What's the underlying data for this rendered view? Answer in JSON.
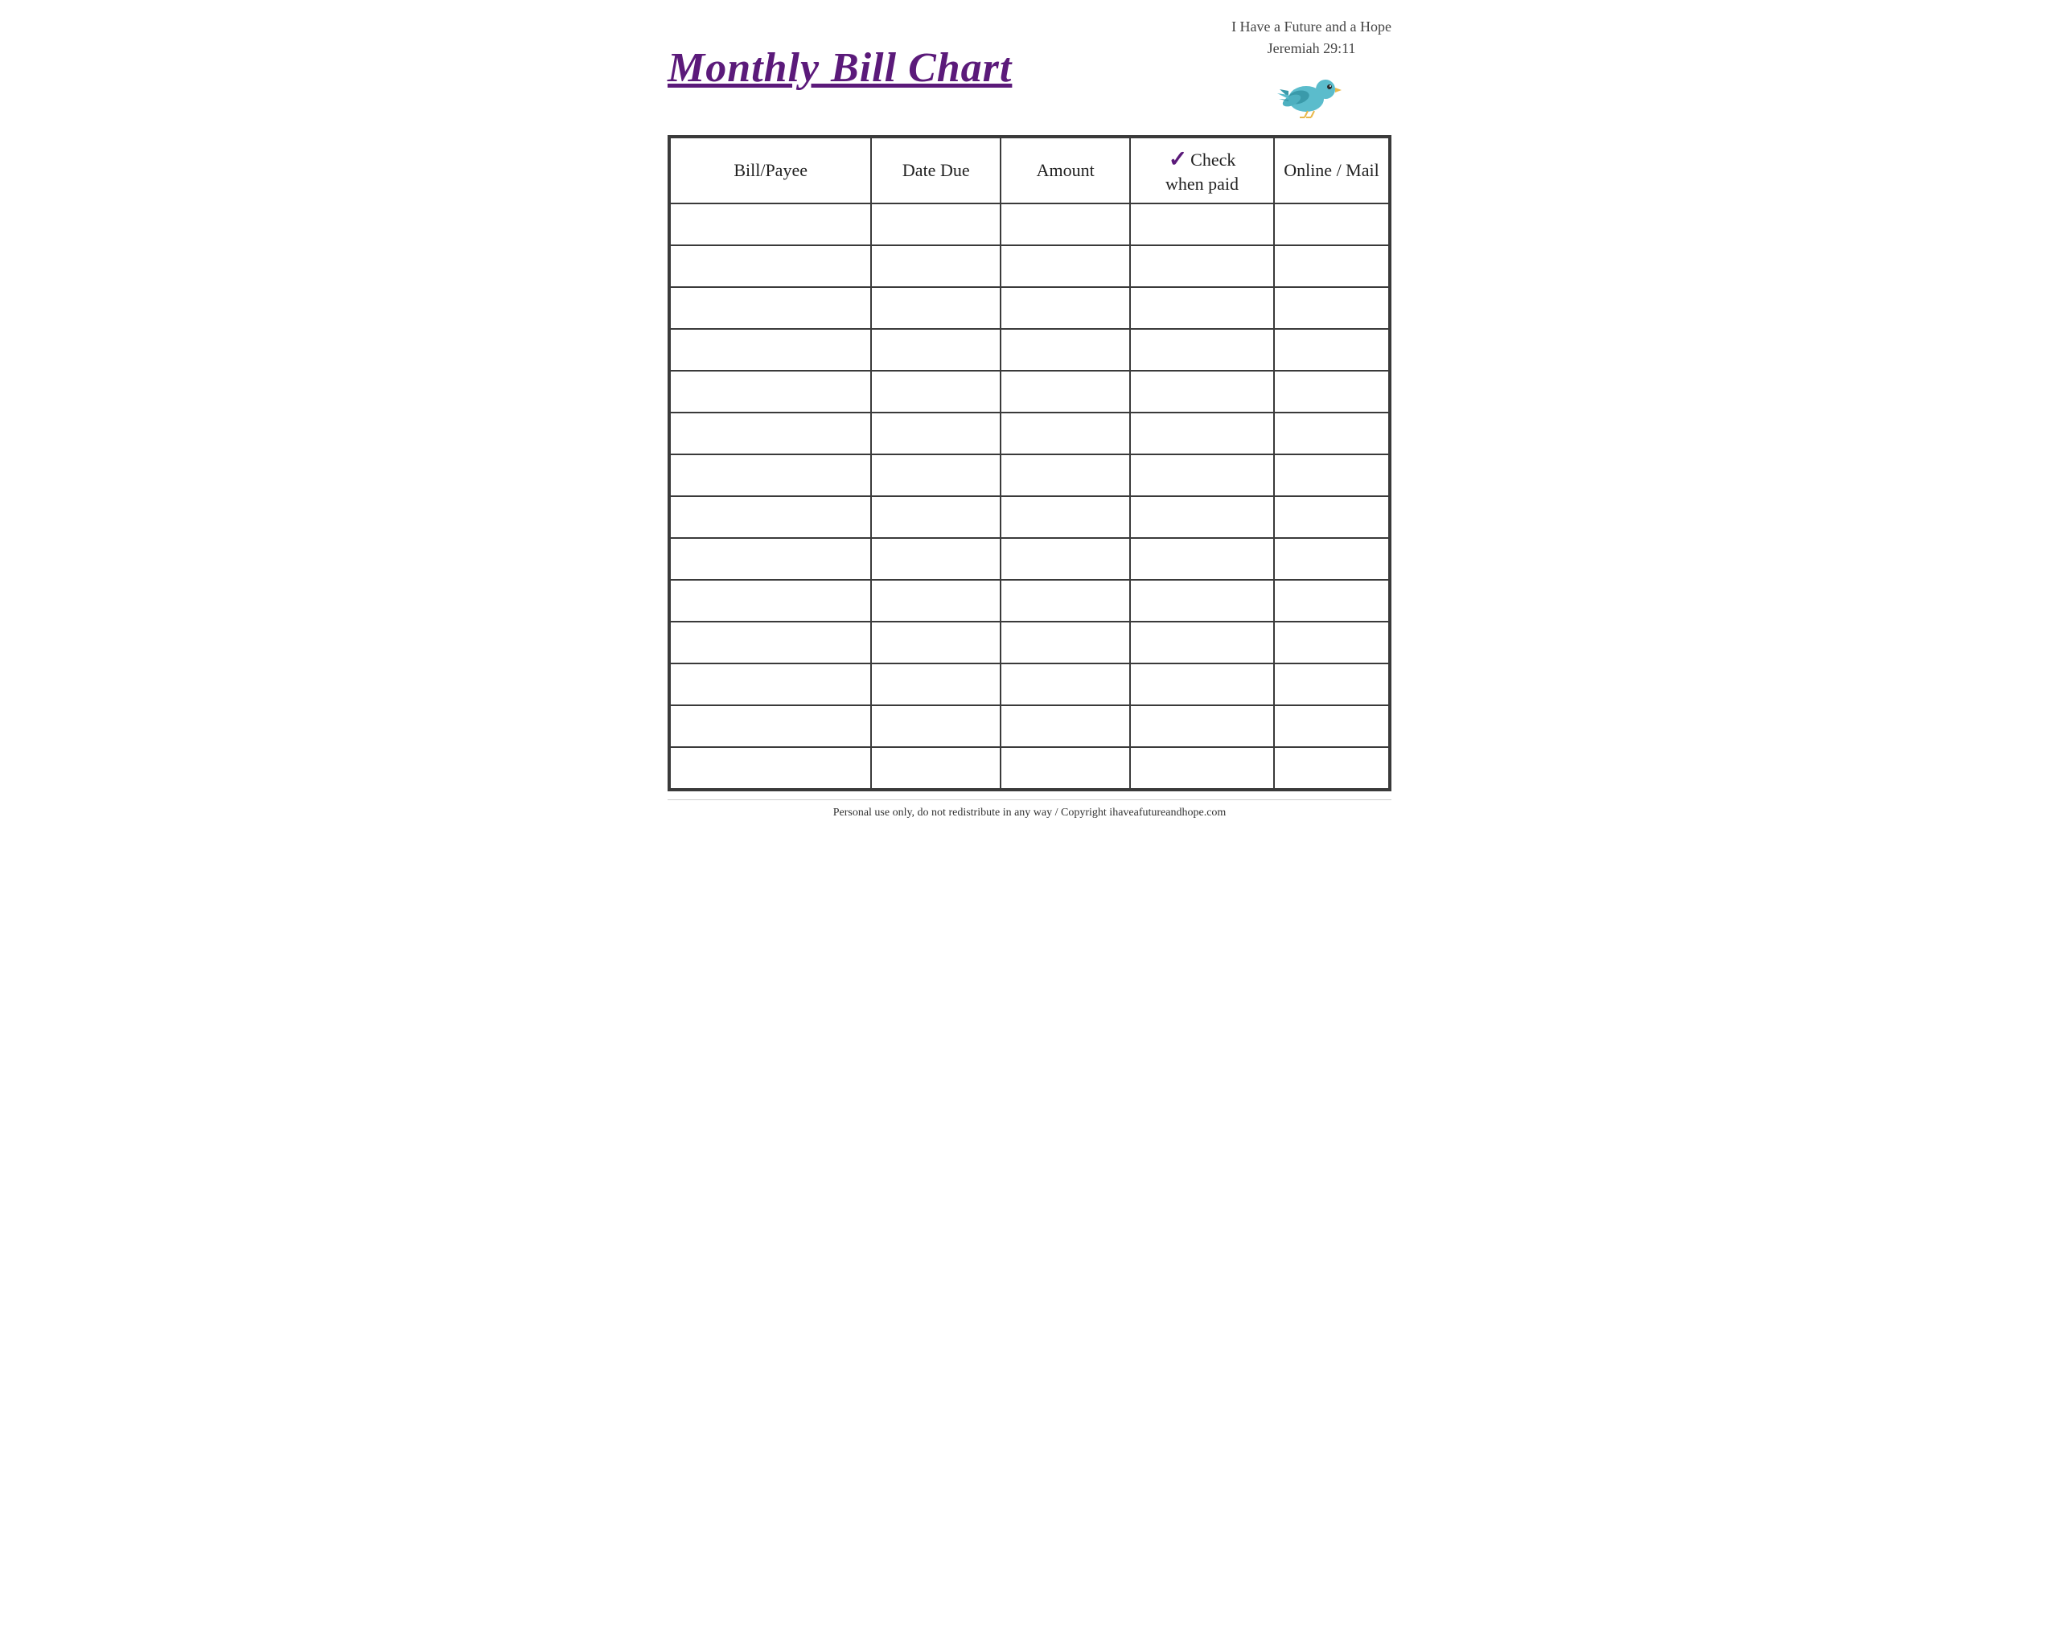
{
  "header": {
    "title": "Monthly Bill Chart",
    "verse_line1": "I Have a Future and a Hope",
    "verse_line2": "Jeremiah 29:11"
  },
  "table": {
    "columns": [
      {
        "id": "bill-payee",
        "label": "Bill/Payee"
      },
      {
        "id": "date-due",
        "label": "Date Due"
      },
      {
        "id": "amount",
        "label": "Amount"
      },
      {
        "id": "check-when-paid",
        "label_top": "Check",
        "label_bottom": "when paid",
        "checkmark": "✓"
      },
      {
        "id": "online-mail",
        "label": "Online / Mail"
      }
    ],
    "row_count": 14
  },
  "footer": {
    "text": "Personal use only, do not redistribute in any way / Copyright ihaveafutureandhope.com"
  },
  "colors": {
    "title": "#5b1a7a",
    "checkmark": "#5b1a7a",
    "border": "#3a3a3a",
    "text": "#222222"
  }
}
